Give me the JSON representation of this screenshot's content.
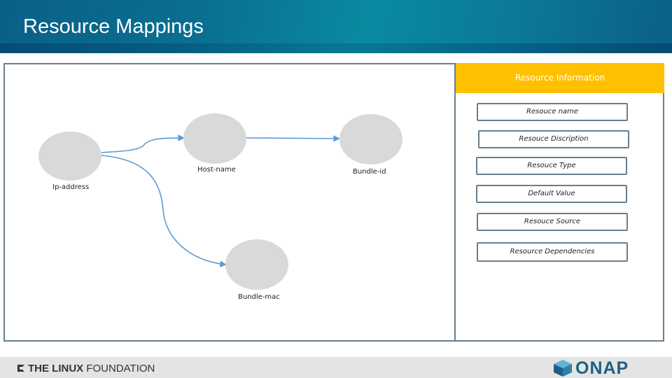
{
  "header": {
    "title": "Resource Mappings"
  },
  "diagram": {
    "nodes": [
      {
        "id": "ip",
        "label": "Ip-address"
      },
      {
        "id": "host",
        "label": "Host-name"
      },
      {
        "id": "bundle_id",
        "label": "Bundle-id"
      },
      {
        "id": "bundle_mac",
        "label": "Bundle-mac"
      }
    ]
  },
  "info_panel": {
    "title": "Resource Information",
    "fields": [
      "Resouce name",
      "Resouce Discription",
      "Resouce Type",
      "Default Value",
      "Resouce Source",
      "Resource Dependencies"
    ]
  },
  "footer": {
    "linux_foundation": {
      "brand_bold": "THE LINUX",
      "brand_light": " FOUNDATION"
    },
    "onap": {
      "text": "ONAP"
    }
  },
  "colors": {
    "header_bg": "#0a7a98",
    "panel_header": "#ffc000",
    "node_fill": "#d9d9d9",
    "edge": "#5b9bd5",
    "onap_blue": "#1f5f86"
  }
}
